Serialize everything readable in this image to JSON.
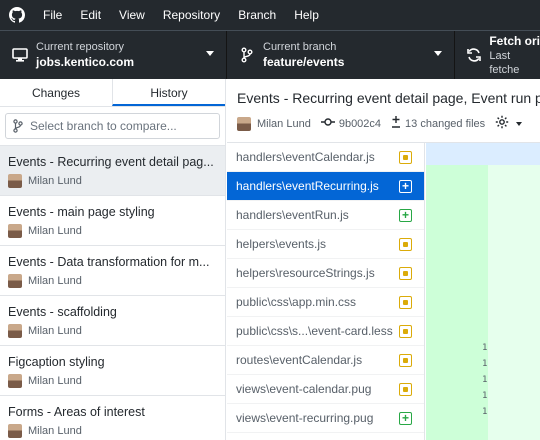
{
  "menubar": {
    "items": [
      "File",
      "Edit",
      "View",
      "Repository",
      "Branch",
      "Help"
    ]
  },
  "toolbar": {
    "repo_label": "Current repository",
    "repo_value": "jobs.kentico.com",
    "branch_label": "Current branch",
    "branch_value": "feature/events",
    "fetch_label": "Fetch ori",
    "fetch_sub": "Last fetche"
  },
  "sidebar": {
    "tabs": [
      "Changes",
      "History"
    ],
    "active_tab": "History",
    "branch_filter_placeholder": "Select branch to compare...",
    "commits": [
      {
        "title": "Events - Recurring event detail pag...",
        "author": "Milan Lund"
      },
      {
        "title": "Events - main page styling",
        "author": "Milan Lund"
      },
      {
        "title": "Events - Data transformation for m...",
        "author": "Milan Lund"
      },
      {
        "title": "Events - scaffolding",
        "author": "Milan Lund"
      },
      {
        "title": "Figcaption styling",
        "author": "Milan Lund"
      },
      {
        "title": "Forms - Areas of interest",
        "author": "Milan Lund"
      }
    ]
  },
  "commit_detail": {
    "title": "Events - Recurring event detail page, Event run p",
    "author": "Milan Lund",
    "sha": "9b002c4",
    "changed_files": "13 changed files"
  },
  "files": [
    {
      "path": "handlers\\eventCalendar.js",
      "status": "modified"
    },
    {
      "path": "handlers\\eventRecurring.js",
      "status": "added"
    },
    {
      "path": "handlers\\eventRun.js",
      "status": "added"
    },
    {
      "path": "helpers\\events.js",
      "status": "modified"
    },
    {
      "path": "helpers\\resourceStrings.js",
      "status": "modified"
    },
    {
      "path": "public\\css\\app.min.css",
      "status": "modified"
    },
    {
      "path": "public\\css\\s...\\event-card.less",
      "status": "modified"
    },
    {
      "path": "routes\\eventCalendar.js",
      "status": "modified"
    },
    {
      "path": "views\\event-calendar.pug",
      "status": "modified"
    },
    {
      "path": "views\\event-recurring.pug",
      "status": "added"
    }
  ],
  "diff": {
    "line_numbers": [
      "1",
      "1",
      "1",
      "1",
      "1"
    ]
  },
  "colors": {
    "titlebar": "#24292e",
    "accent": "#0366d6",
    "modified": "#dbab09",
    "added": "#28a745",
    "diff_added_bg": "#e6ffed"
  }
}
